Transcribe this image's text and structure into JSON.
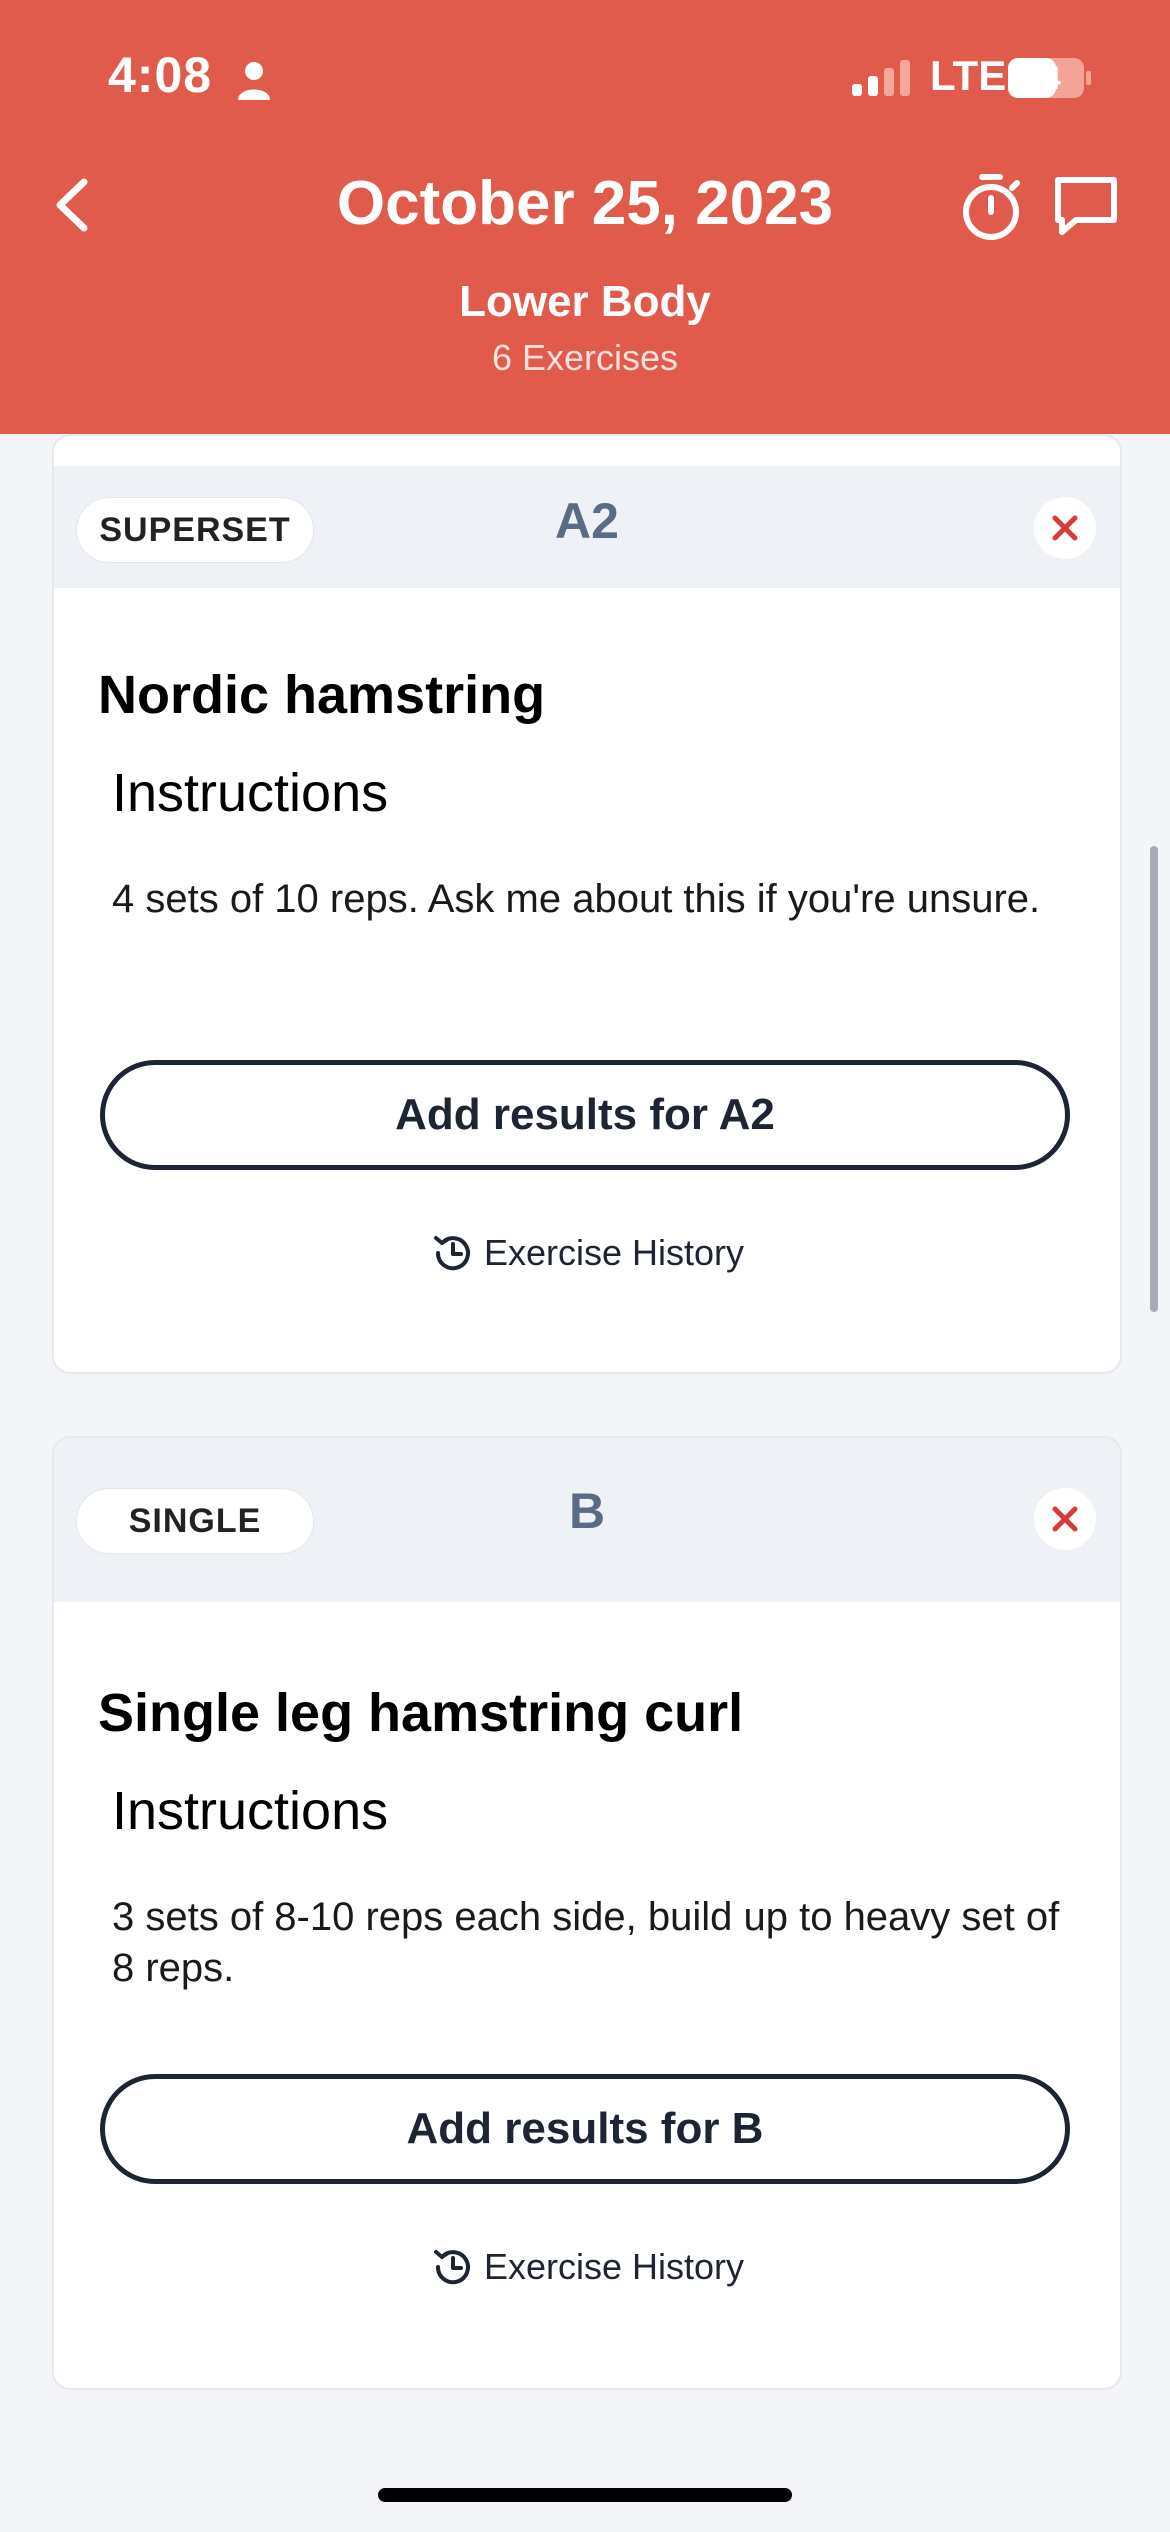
{
  "status_bar": {
    "time": "4:08",
    "network": "LTE",
    "battery": "64"
  },
  "header": {
    "title": "October 25, 2023",
    "subtitle": "Lower Body",
    "exercise_count": "6 Exercises",
    "back_icon": "chevron-left-icon",
    "timer_icon": "stopwatch-icon",
    "chat_icon": "chat-bubble-icon"
  },
  "cards": [
    {
      "type": "SUPERSET",
      "group": "A2",
      "exercise": "Nordic hamstring",
      "instructions_heading": "Instructions",
      "instructions": "4 sets of 10 reps. Ask me about this if you're unsure.",
      "add_button": "Add results for A2",
      "history_link": "Exercise History"
    },
    {
      "type": "SINGLE",
      "group": "B",
      "exercise": "Single leg hamstring curl",
      "instructions_heading": "Instructions",
      "instructions": "3 sets of 8-10 reps each side, build up to heavy set of 8 reps.",
      "add_button": "Add results for B",
      "history_link": "Exercise History"
    }
  ],
  "colors": {
    "header": "#e05b4b",
    "close_x": "#d63a3a",
    "group_label": "#5a6b86",
    "button_border": "#1d2433"
  }
}
